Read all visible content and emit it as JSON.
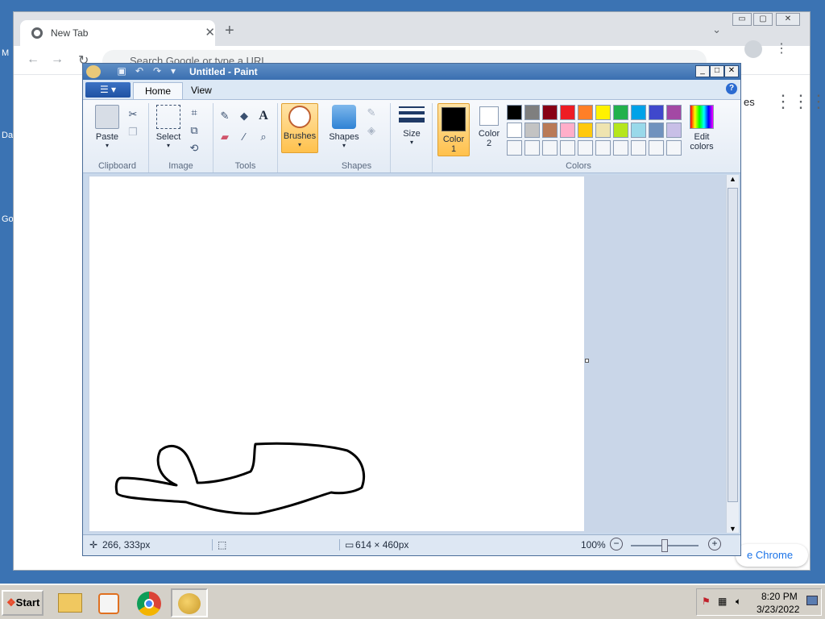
{
  "desktop": {
    "label_m": "M",
    "label_da": "Da",
    "label_go": "Go"
  },
  "chrome": {
    "tab_title": "New Tab",
    "tab_close": "✕",
    "new_tab": "+",
    "tab_search": "⌄",
    "omnibox_placeholder": "Search Google or type a URL",
    "images_partial": "es",
    "customize_partial": "e Chrome",
    "win_min": "▭",
    "win_max": "▢",
    "win_close": "✕"
  },
  "paint": {
    "title": "Untitled - Paint",
    "tabs": {
      "home": "Home",
      "view": "View"
    },
    "groups": {
      "clipboard": "Clipboard",
      "image": "Image",
      "tools": "Tools",
      "shapes": "Shapes",
      "colors": "Colors"
    },
    "buttons": {
      "paste": "Paste",
      "select": "Select",
      "brushes": "Brushes",
      "shapes": "Shapes",
      "size": "Size",
      "color1_a": "Color",
      "color1_b": "1",
      "color2_a": "Color",
      "color2_b": "2",
      "edit_colors_a": "Edit",
      "edit_colors_b": "colors"
    },
    "color1": "#000000",
    "color2": "#ffffff",
    "palette_row1": [
      "#000000",
      "#7f7f7f",
      "#880015",
      "#ed1c24",
      "#ff7f27",
      "#fff200",
      "#22b14c",
      "#00a2e8",
      "#3f48cc",
      "#a349a4"
    ],
    "palette_row2": [
      "#ffffff",
      "#c3c3c3",
      "#b97a57",
      "#ffaec9",
      "#ffc90e",
      "#efe4b0",
      "#b5e61d",
      "#99d9ea",
      "#7092be",
      "#c8bfe7"
    ],
    "status": {
      "cursor": "266, 333px",
      "selection": "",
      "size": "614 × 460px",
      "zoom": "100%"
    }
  },
  "taskbar": {
    "start": "Start",
    "time": "8:20 PM",
    "date": "3/23/2022"
  }
}
